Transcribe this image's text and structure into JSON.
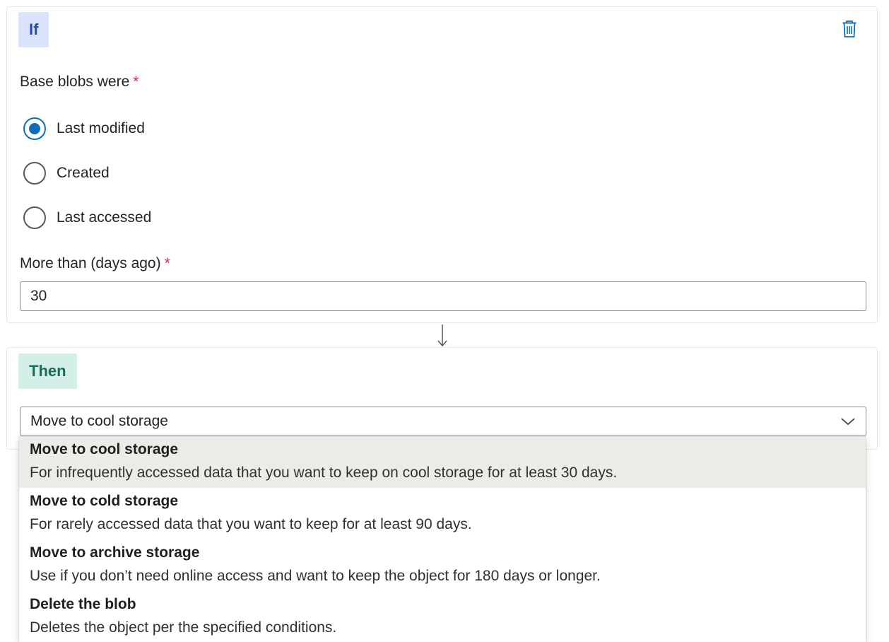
{
  "if_block": {
    "tag": "If",
    "delete_icon": "trash-icon",
    "base_label": "Base blobs were",
    "required_mark": "*",
    "radio_options": [
      "Last modified",
      "Created",
      "Last accessed"
    ],
    "selected_radio": "Last modified",
    "days_label": "More than (days ago)",
    "days_value": "30"
  },
  "then_block": {
    "tag": "Then",
    "action_value": "Move to cool storage",
    "dropdown_icon": "chevron-down-icon"
  },
  "dropdown": {
    "options": [
      {
        "title": "Move to cool storage",
        "description": "For infrequently accessed data that you want to keep on cool storage for at least 30 days."
      },
      {
        "title": "Move to cold storage",
        "description": "For rarely accessed data that you want to keep for at least 90 days."
      },
      {
        "title": "Move to archive storage",
        "description": "Use if you don’t need online access and want to keep the object for 180 days or longer."
      },
      {
        "title": "Delete the blob",
        "description": "Deletes the object per the specified conditions."
      }
    ],
    "selected": "Move to cool storage"
  },
  "colors": {
    "accent": "#0f6cbd",
    "if_tag_bg": "#dbe3fa",
    "then_tag_bg": "#d3efe7",
    "required": "#c4314b",
    "selected_option_bg": "#ebebe8"
  }
}
